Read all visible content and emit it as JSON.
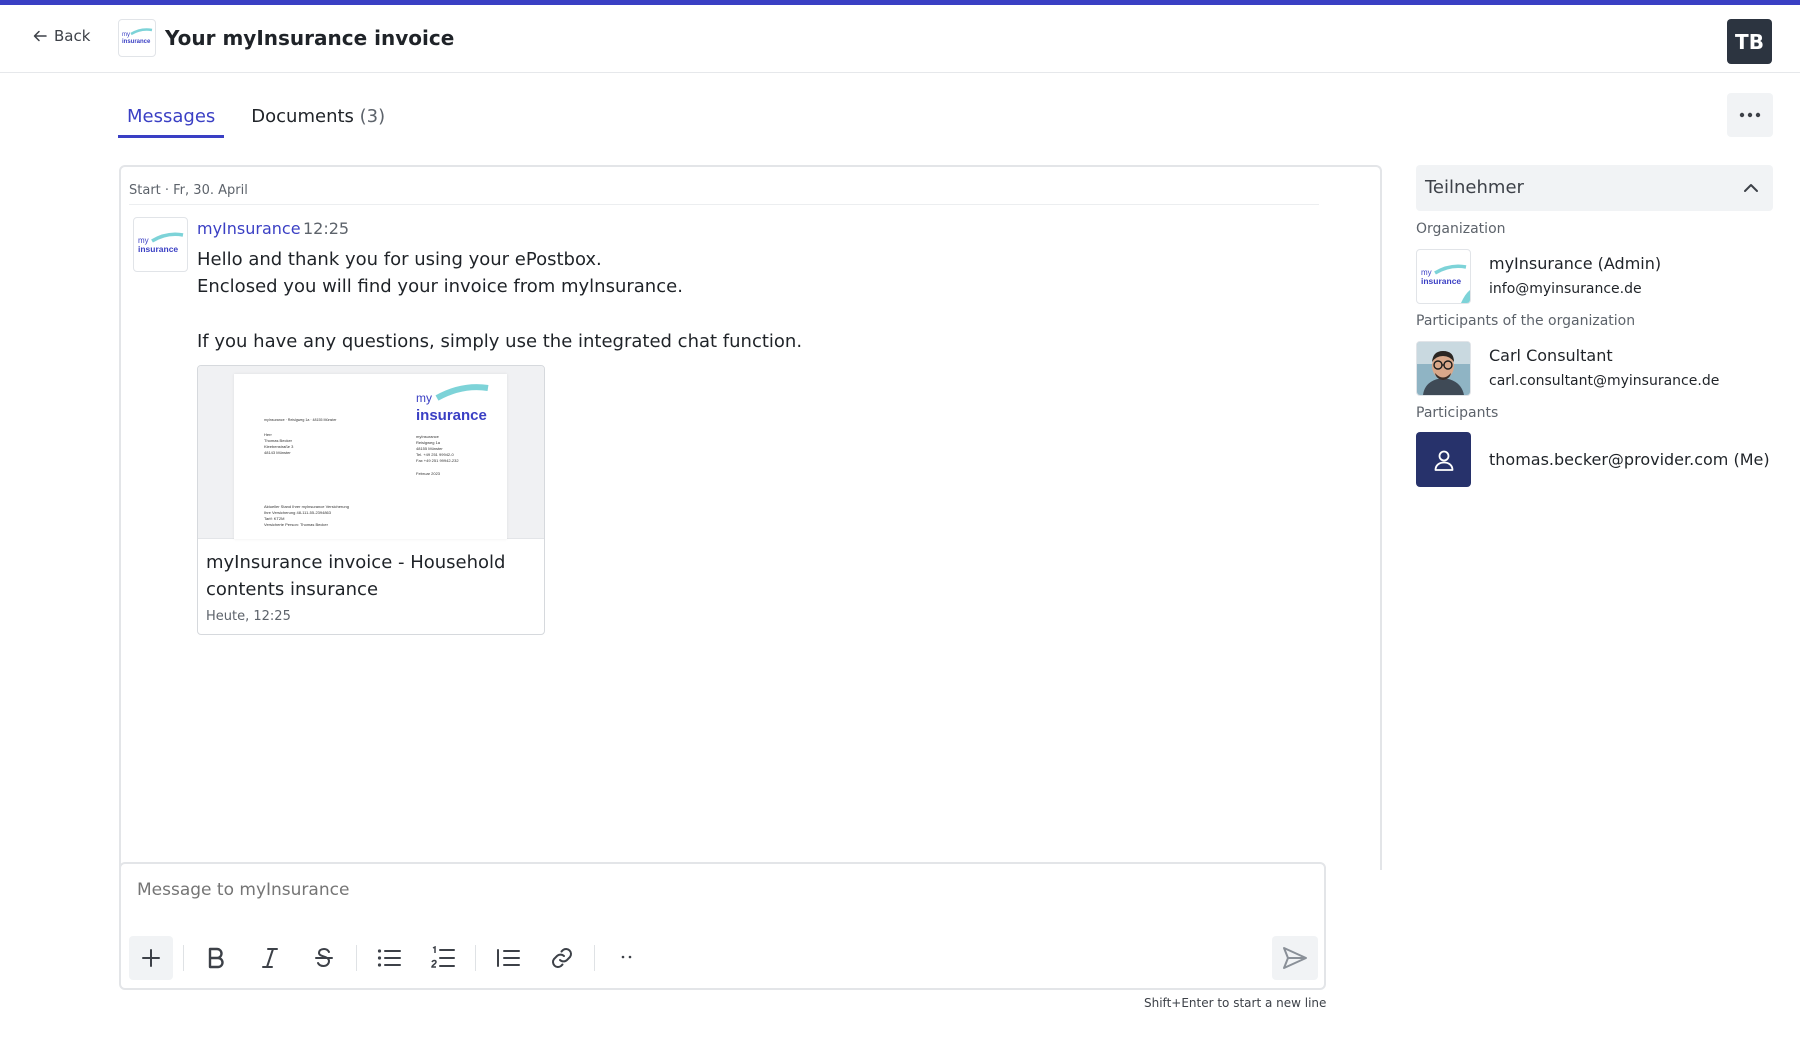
{
  "header": {
    "back_label": "Back",
    "title": "Your myInsurance invoice",
    "avatar_initials": "TB"
  },
  "tabs": [
    {
      "label": "Messages",
      "count": ""
    },
    {
      "label": "Documents",
      "count": "(3)"
    }
  ],
  "chat": {
    "date_divider": "Start · Fr, 30. April",
    "message": {
      "sender": "myInsurance",
      "time": "12:25",
      "lines": [
        "Hello and thank you for using your ePostbox.",
        "Enclosed you will find your invoice from mylnsurance.",
        "If you have any questions, simply use the integrated chat function."
      ]
    },
    "attachment": {
      "title": "myInsurance invoice - Household contents insurance",
      "date": "Heute, 12:25",
      "preview": {
        "logo_top": "my",
        "logo_bottom": "insurance",
        "sender_line": "myInsurance · Reislgweg 1a · 48155 Münster",
        "recipient": [
          "Herr",
          "Thomas Becker",
          "Kleebenstraße 3",
          "48143 Münster"
        ],
        "company": [
          "myInsurance",
          "Reislgweg 1a",
          "48155 Münster",
          "Tel. +49 251 99942-0",
          "Fax +49 251 99942-232"
        ],
        "date": "Februar 2023",
        "subject": [
          "Aktueller Stand Ihrer myInsurance Versicherung",
          "Ihre Versicherung 48-111-55-2394863",
          "Tarif: KT2M",
          "Versicherte Person: Thomas Becker"
        ]
      }
    }
  },
  "composer": {
    "placeholder": "Message to myInsurance",
    "hint": "Shift+Enter to start a new line"
  },
  "sidebar": {
    "title": "Teilnehmer",
    "organization_label": "Organization",
    "organization": {
      "name": "myInsurance (Admin)",
      "email": "info@myinsurance.de"
    },
    "org_participants_label": "Participants of the organization",
    "consultant": {
      "name": "Carl Consultant",
      "email": "carl.consultant@myinsurance.de"
    },
    "participants_label": "Participants",
    "me": {
      "email": "thomas.becker@provider.com (Me)"
    }
  },
  "colors": {
    "accent": "#3a3fc4",
    "logo_teal": "#7dd3d8",
    "logo_blue": "#3a3fc4",
    "me_avatar": "#27326b",
    "tb_avatar": "#2c3440"
  },
  "logo": {
    "line1": "my",
    "line2": "insurance"
  }
}
